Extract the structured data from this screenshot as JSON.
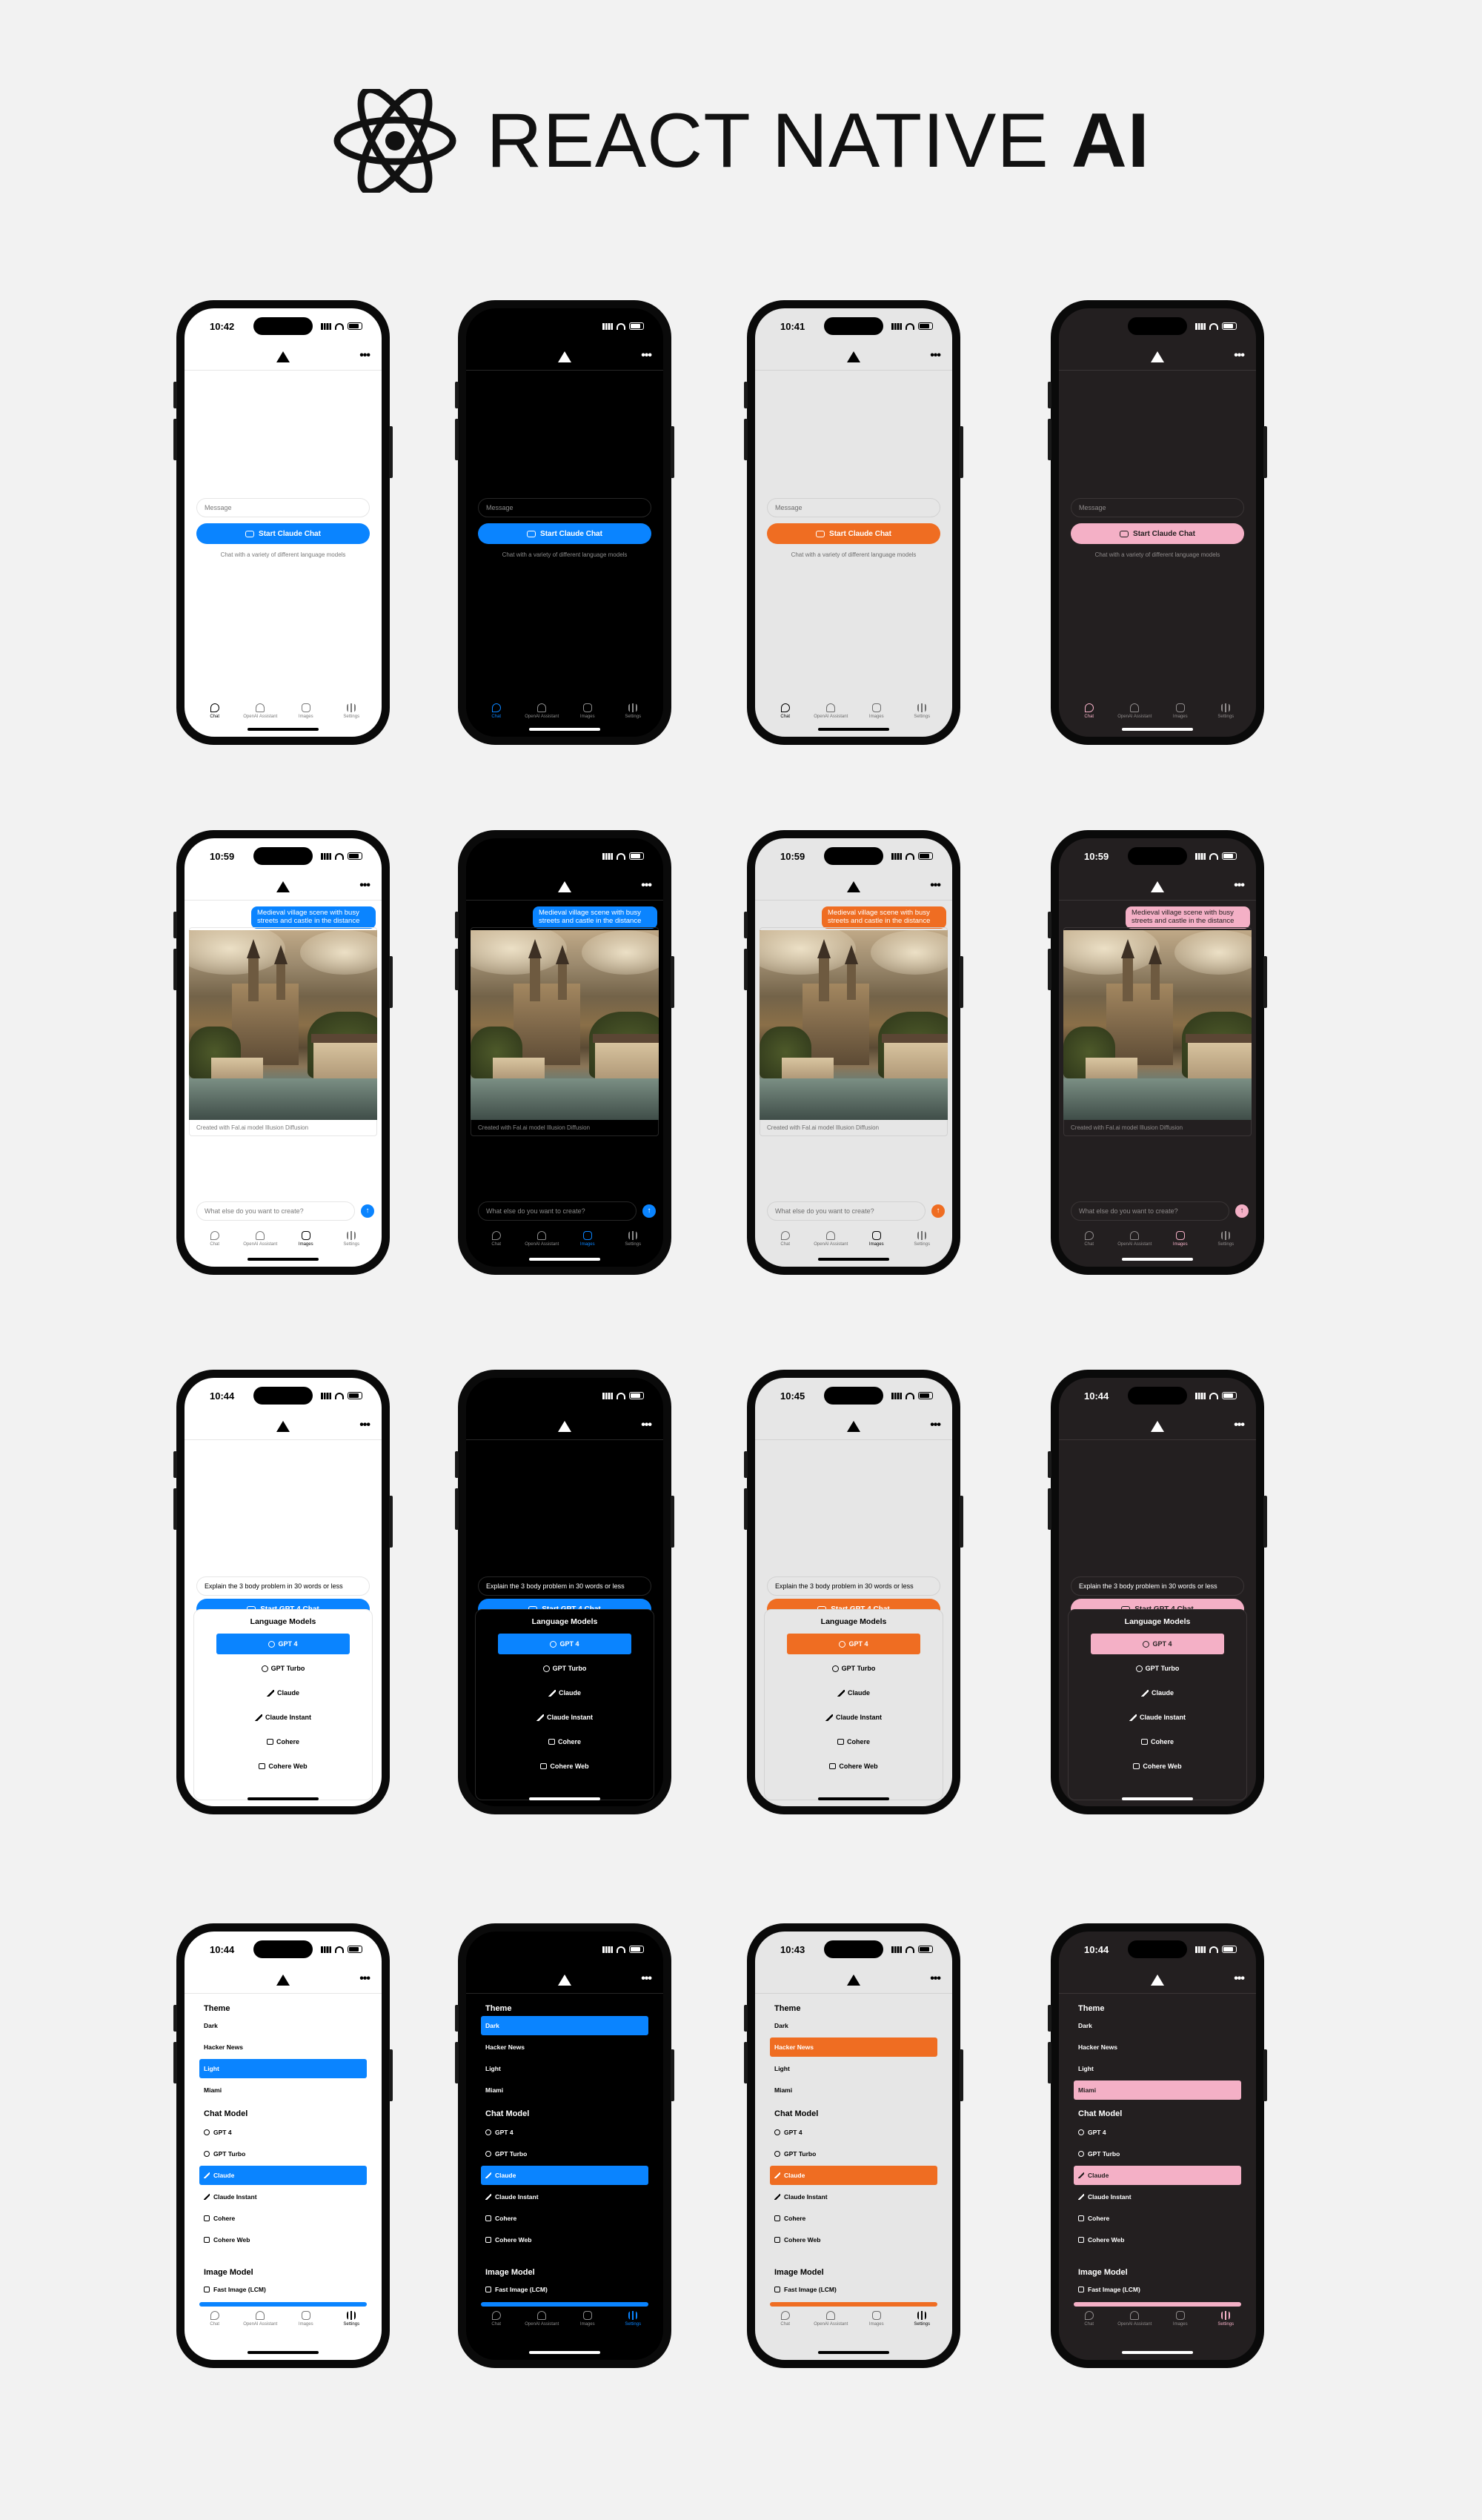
{
  "header": {
    "title_regular": "REACT NATIVE",
    "title_bold": "AI",
    "logo": "react-atom-logo"
  },
  "themes": [
    {
      "name": "light",
      "bg": "#ffffff",
      "fg": "#000000",
      "sub": "#7a7a7a",
      "line": "#e6e6e6",
      "input": "#ffffff",
      "accent": "#0a84ff",
      "btxt": "#ffffff",
      "tabact": "#000000",
      "time": "10:42",
      "time_r2": "10:59",
      "time_r3": "10:44",
      "time_r4": "10:44"
    },
    {
      "name": "dark",
      "bg": "#000000",
      "fg": "#ffffff",
      "sub": "#8a8a8a",
      "line": "#262626",
      "input": "#000000",
      "accent": "#0a84ff",
      "btxt": "#ffffff",
      "tabact": "#0a84ff",
      "time": "",
      "time_r2": "",
      "time_r3": "",
      "time_r4": ""
    },
    {
      "name": "hacker-news",
      "bg": "#e6e6e6",
      "fg": "#000000",
      "sub": "#6e6e6e",
      "line": "#d2d2d2",
      "input": "#e6e6e6",
      "accent": "#ef6d22",
      "btxt": "#ffffff",
      "tabact": "#000000",
      "time": "10:41",
      "time_r2": "10:59",
      "time_r3": "10:45",
      "time_r4": "10:43"
    },
    {
      "name": "miami",
      "bg": "#231f20",
      "fg": "#ffffff",
      "sub": "#8e8a8a",
      "line": "#3a3536",
      "input": "#231f20",
      "accent": "#f4b0c6",
      "btxt": "#231f20",
      "tabact": "#f4b0c6",
      "time": "",
      "time_r2": "10:59",
      "time_r3": "10:44",
      "time_r4": "10:44"
    }
  ],
  "chat": {
    "message_placeholder": "Message",
    "start_button": "Start Claude Chat",
    "caption": "Chat with a variety of different language models"
  },
  "tabs": [
    "Chat",
    "OpenAI Assistant",
    "Images",
    "Settings"
  ],
  "images": {
    "prompt": "Medieval village scene with busy streets and castle in the distance",
    "caption": "Created with Fal.ai model Illusion Diffusion",
    "input_placeholder": "What else do you want to create?"
  },
  "models": {
    "prompt": "Explain the 3 body problem in 30 words or less",
    "start_button": "Start GPT 4 Chat",
    "sheet_title": "Language Models",
    "items": [
      "GPT 4",
      "GPT Turbo",
      "Claude",
      "Claude Instant",
      "Cohere",
      "Cohere Web"
    ],
    "selected": 0
  },
  "settings": {
    "theme_title": "Theme",
    "theme_options": [
      "Dark",
      "Hacker News",
      "Light",
      "Miami"
    ],
    "chat_title": "Chat Model",
    "chat_options": [
      "GPT 4",
      "GPT Turbo",
      "Claude",
      "Claude Instant",
      "Cohere",
      "Cohere Web"
    ],
    "chat_selected": 2,
    "image_title": "Image Model",
    "image_options": [
      "Fast Image (LCM)"
    ]
  }
}
